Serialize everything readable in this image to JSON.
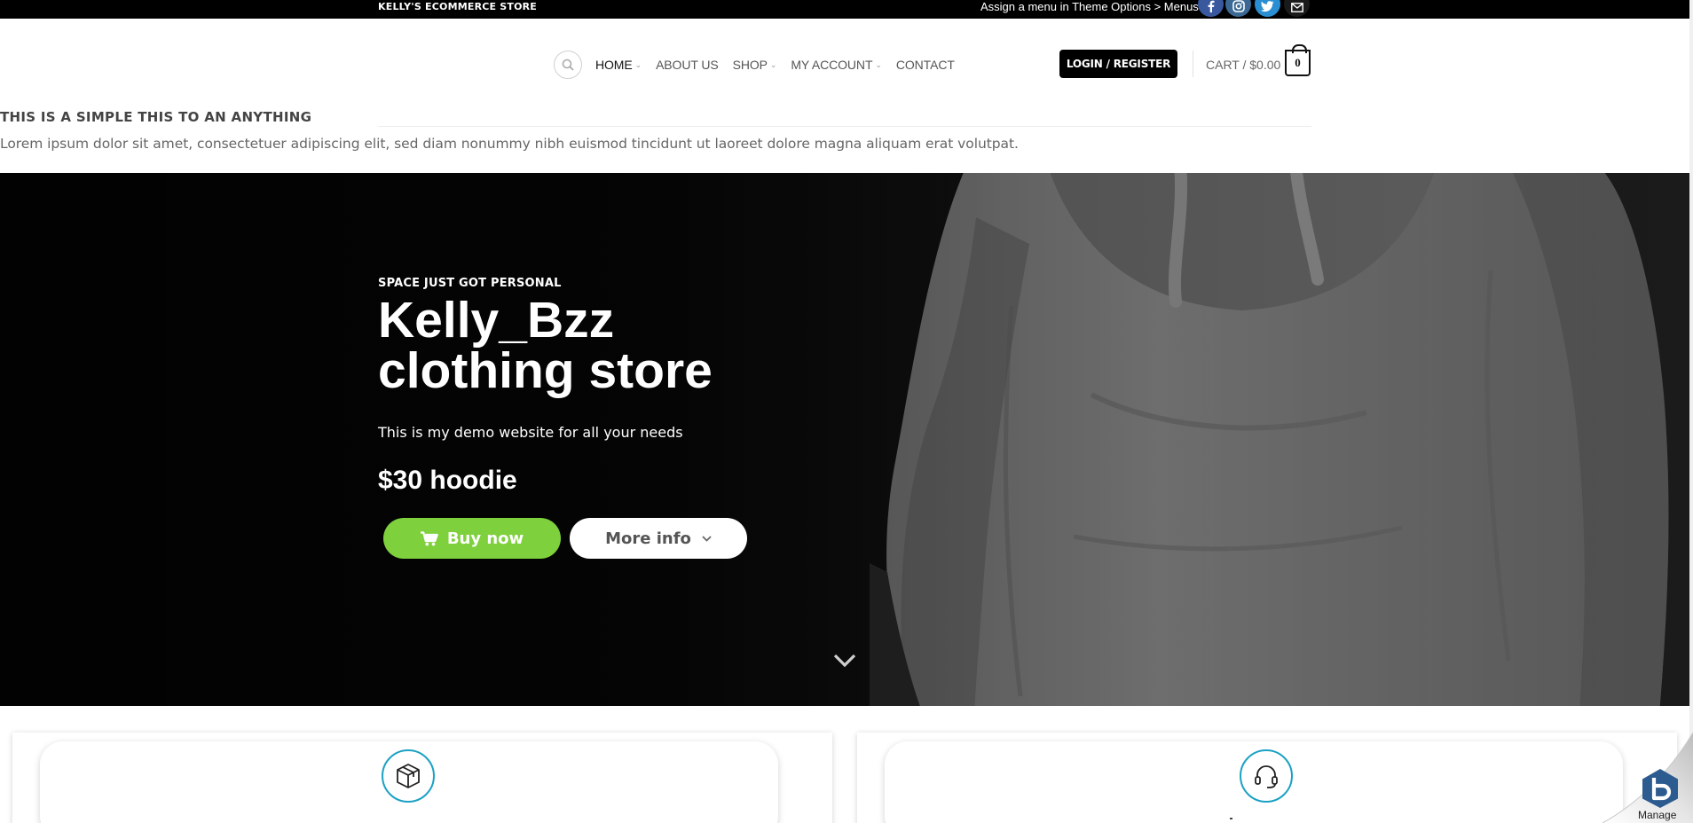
{
  "topbar": {
    "store_name": "KELLY'S ECOMMERCE STORE",
    "menu_hint": "Assign a menu in Theme Options > Menus",
    "social": [
      "facebook-icon",
      "instagram-icon",
      "twitter-icon",
      "email-icon"
    ]
  },
  "header": {
    "nav": [
      {
        "label": "HOME",
        "has_dropdown": true
      },
      {
        "label": "ABOUT US",
        "has_dropdown": false
      },
      {
        "label": "SHOP",
        "has_dropdown": true
      },
      {
        "label": "MY ACCOUNT",
        "has_dropdown": true
      },
      {
        "label": "CONTACT",
        "has_dropdown": false
      }
    ],
    "login_label": "LOGIN / REGISTER",
    "cart_label": "CART / $0.00",
    "cart_count": "0"
  },
  "notice": {
    "title": "THIS IS A SIMPLE THIS TO AN ANYTHING",
    "text": "Lorem ipsum dolor sit amet, consectetuer adipiscing elit, sed diam nonummy nibh euismod tincidunt ut laoreet dolore magna aliquam erat volutpat."
  },
  "hero": {
    "kicker": "SPACE JUST GOT PERSONAL",
    "title_line1": "Kelly_Bzz",
    "title_line2": "clothing store",
    "subtitle": "This is my demo website for all your needs",
    "price": "$30 hoodie",
    "buy_label": "Buy now",
    "more_label": "More info"
  },
  "features": {
    "left_icon": "box-icon",
    "right_icon": "headset-icon"
  },
  "manage": {
    "label": "Manage"
  },
  "colors": {
    "accent_green": "#7ed13c",
    "feature_icon_border": "#1ba1c5",
    "topbar_bg": "#000000"
  }
}
